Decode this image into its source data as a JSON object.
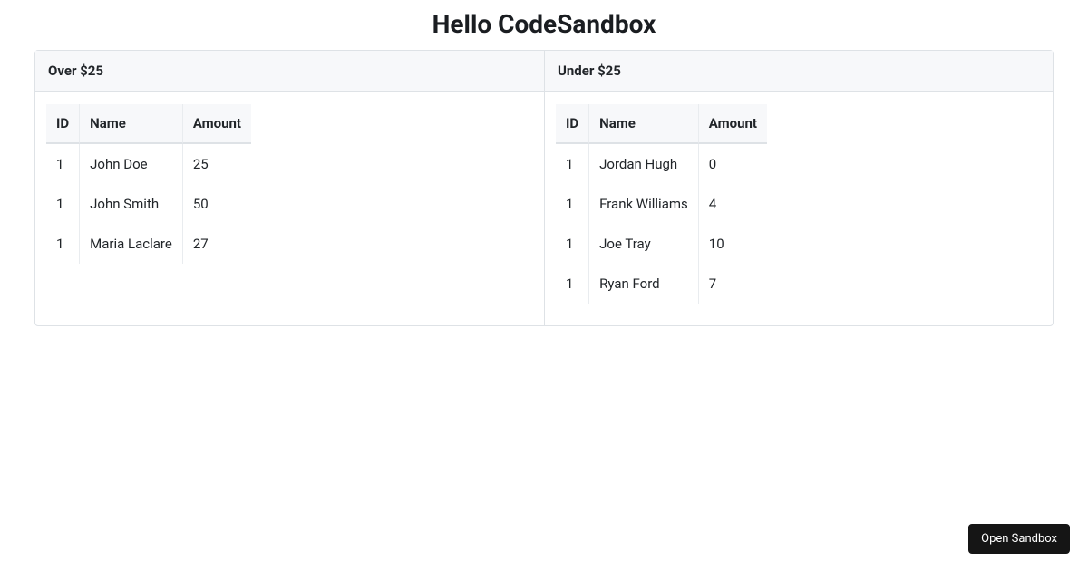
{
  "title": "Hello CodeSandbox",
  "panels": {
    "over": {
      "title": "Over $25",
      "columns": {
        "id": "ID",
        "name": "Name",
        "amount": "Amount"
      },
      "rows": [
        {
          "id": "1",
          "name": "John Doe",
          "amount": "25"
        },
        {
          "id": "1",
          "name": "John Smith",
          "amount": "50"
        },
        {
          "id": "1",
          "name": "Maria Laclare",
          "amount": "27"
        }
      ]
    },
    "under": {
      "title": "Under $25",
      "columns": {
        "id": "ID",
        "name": "Name",
        "amount": "Amount"
      },
      "rows": [
        {
          "id": "1",
          "name": "Jordan Hugh",
          "amount": "0"
        },
        {
          "id": "1",
          "name": "Frank Williams",
          "amount": "4"
        },
        {
          "id": "1",
          "name": "Joe Tray",
          "amount": "10"
        },
        {
          "id": "1",
          "name": "Ryan Ford",
          "amount": "7"
        }
      ]
    }
  },
  "open_sandbox_label": "Open Sandbox"
}
